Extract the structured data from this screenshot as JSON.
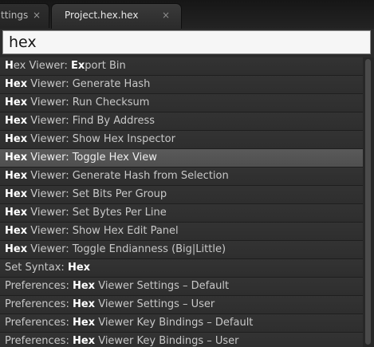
{
  "tabs": [
    {
      "label": "ttings",
      "close": "×",
      "active": false
    },
    {
      "label": "Project.hex.hex",
      "close": "×",
      "active": true
    }
  ],
  "palette": {
    "query": "hex",
    "items": [
      {
        "parts": [
          [
            "H",
            "b"
          ],
          [
            "ex Viewer: ",
            ""
          ],
          [
            "Ex",
            "b"
          ],
          [
            "port Bin",
            ""
          ]
        ],
        "selected": false
      },
      {
        "parts": [
          [
            "Hex",
            "b"
          ],
          [
            " Viewer: Generate Hash",
            ""
          ]
        ],
        "selected": false
      },
      {
        "parts": [
          [
            "Hex",
            "b"
          ],
          [
            " Viewer: Run Checksum",
            ""
          ]
        ],
        "selected": false
      },
      {
        "parts": [
          [
            "Hex",
            "b"
          ],
          [
            " Viewer: Find By Address",
            ""
          ]
        ],
        "selected": false
      },
      {
        "parts": [
          [
            "Hex",
            "b"
          ],
          [
            " Viewer: Show Hex Inspector",
            ""
          ]
        ],
        "selected": false
      },
      {
        "parts": [
          [
            "Hex",
            "b"
          ],
          [
            " Viewer: Toggle Hex View",
            ""
          ]
        ],
        "selected": true
      },
      {
        "parts": [
          [
            "Hex",
            "b"
          ],
          [
            " Viewer: Generate Hash from Selection",
            ""
          ]
        ],
        "selected": false
      },
      {
        "parts": [
          [
            "Hex",
            "b"
          ],
          [
            " Viewer: Set Bits Per Group",
            ""
          ]
        ],
        "selected": false
      },
      {
        "parts": [
          [
            "Hex",
            "b"
          ],
          [
            " Viewer: Set Bytes Per Line",
            ""
          ]
        ],
        "selected": false
      },
      {
        "parts": [
          [
            "Hex",
            "b"
          ],
          [
            " Viewer: Show Hex Edit Panel",
            ""
          ]
        ],
        "selected": false
      },
      {
        "parts": [
          [
            "Hex",
            "b"
          ],
          [
            " Viewer: Toggle Endianness (Big|Little)",
            ""
          ]
        ],
        "selected": false
      },
      {
        "parts": [
          [
            "Set Syntax: ",
            ""
          ],
          [
            "Hex",
            "b"
          ]
        ],
        "selected": false
      },
      {
        "parts": [
          [
            "Preferences: ",
            ""
          ],
          [
            "Hex",
            "b"
          ],
          [
            " Viewer Settings – Default",
            ""
          ]
        ],
        "selected": false
      },
      {
        "parts": [
          [
            "Preferences: ",
            ""
          ],
          [
            "Hex",
            "b"
          ],
          [
            " Viewer Settings – User",
            ""
          ]
        ],
        "selected": false
      },
      {
        "parts": [
          [
            "Preferences: ",
            ""
          ],
          [
            "Hex",
            "b"
          ],
          [
            " Viewer Key Bindings – Default",
            ""
          ]
        ],
        "selected": false
      },
      {
        "parts": [
          [
            "Preferences: ",
            ""
          ],
          [
            "Hex",
            "b"
          ],
          [
            " Viewer Key Bindings – User",
            ""
          ]
        ],
        "selected": false
      }
    ]
  }
}
